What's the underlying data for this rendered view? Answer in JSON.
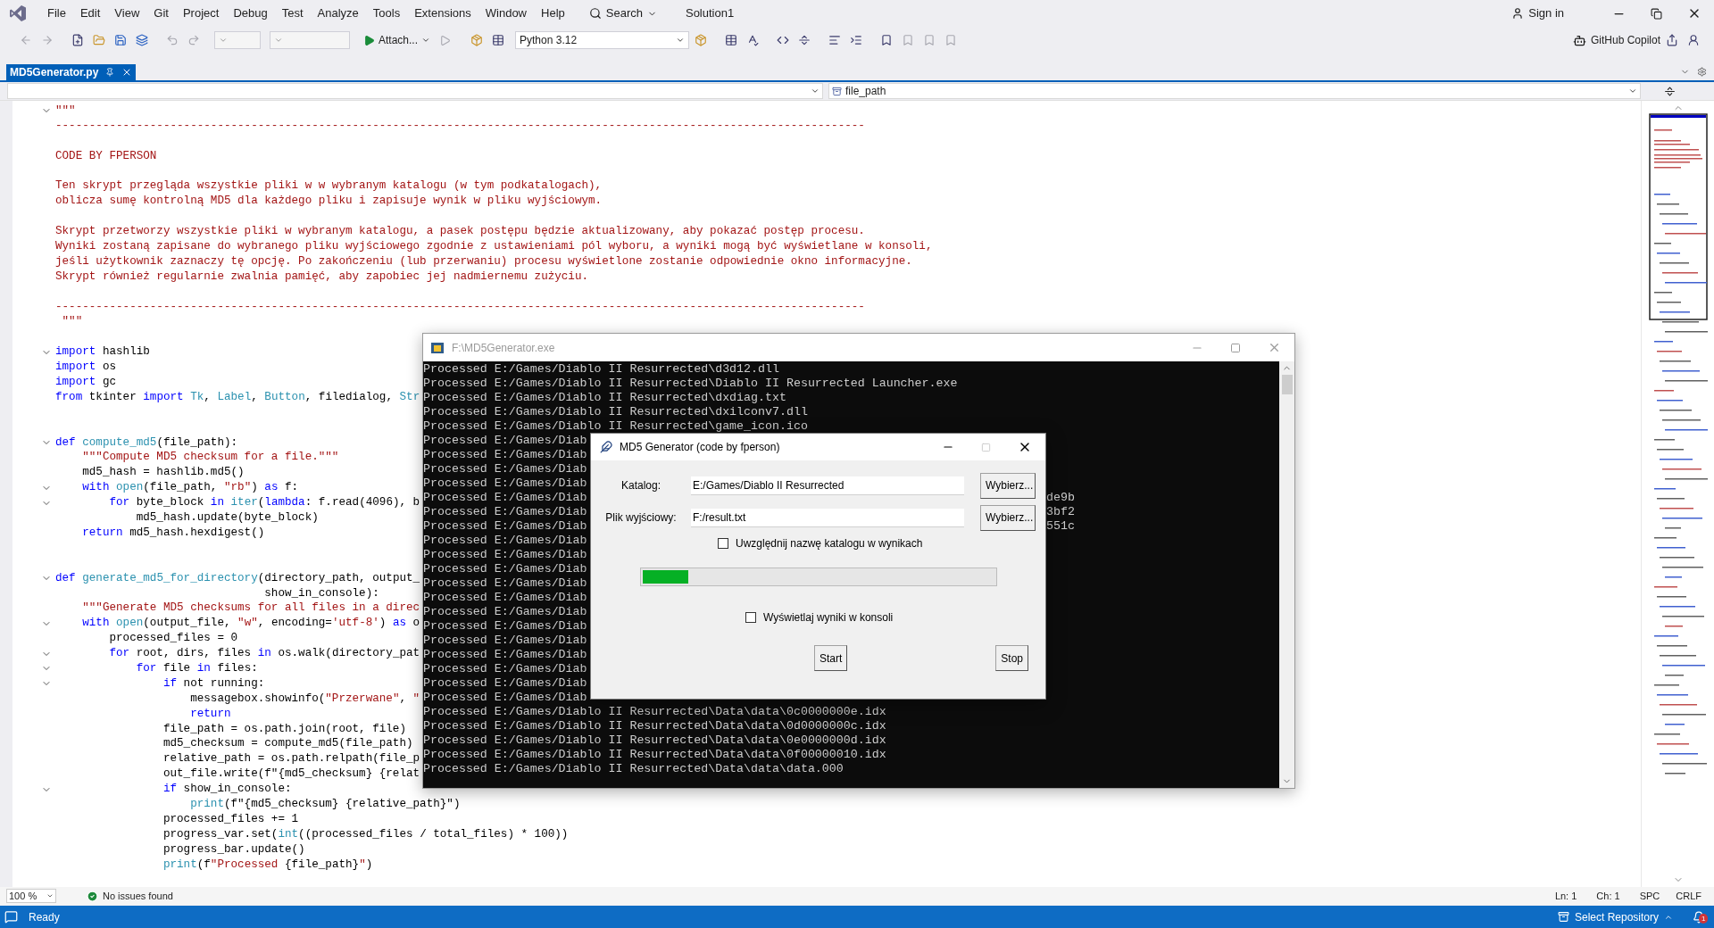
{
  "menu_bar": {
    "items": [
      "File",
      "Edit",
      "View",
      "Git",
      "Project",
      "Debug",
      "Test",
      "Analyze",
      "Tools",
      "Extensions",
      "Window",
      "Help"
    ],
    "search": "Search",
    "solution": "Solution1",
    "sign_in": "Sign in"
  },
  "toolbar": {
    "attach": "Attach...",
    "interpreter": "Python 3.12",
    "copilot": "GitHub Copilot"
  },
  "tabs": [
    {
      "label": "MD5Generator.py",
      "selected": true
    }
  ],
  "navigation": {
    "member": "file_path"
  },
  "editor": {
    "lines": [
      {
        "kind": "code",
        "foldable": true,
        "tokens": [
          {
            "kind": "string",
            "text": "\"\"\""
          }
        ]
      },
      {
        "kind": "code",
        "foldable": false,
        "tokens": [
          {
            "kind": "string",
            "text": "------------------------------------------------------------------------------------------------------------------------"
          }
        ]
      },
      {
        "kind": "blank",
        "foldable": false
      },
      {
        "kind": "code",
        "foldable": false,
        "tokens": [
          {
            "kind": "string",
            "text": "CODE BY FPERSON"
          }
        ]
      },
      {
        "kind": "blank",
        "foldable": false
      },
      {
        "kind": "code",
        "foldable": false,
        "tokens": [
          {
            "kind": "string",
            "text": "Ten skrypt przegląda wszystkie pliki w w wybranym katalogu (w tym podkatalogach),"
          }
        ]
      },
      {
        "kind": "code",
        "foldable": false,
        "tokens": [
          {
            "kind": "string",
            "text": "oblicza sumę kontrolną MD5 dla każdego pliku i zapisuje wynik w pliku wyjściowym."
          }
        ]
      },
      {
        "kind": "blank",
        "foldable": false
      },
      {
        "kind": "code",
        "foldable": false,
        "tokens": [
          {
            "kind": "string",
            "text": "Skrypt przetworzy wszystkie pliki w wybranym katalogu, a pasek postępu będzie aktualizowany, aby pokazać postęp procesu."
          }
        ]
      },
      {
        "kind": "code",
        "foldable": false,
        "tokens": [
          {
            "kind": "string",
            "text": "Wyniki zostaną zapisane do wybranego pliku wyjściowego zgodnie z ustawieniami pól wyboru, a wyniki mogą być wyświetlane w konsoli,"
          }
        ]
      },
      {
        "kind": "code",
        "foldable": false,
        "tokens": [
          {
            "kind": "string",
            "text": "jeśli użytkownik zaznaczy tę opcję. Po zakończeniu (lub przerwaniu) procesu wyświetlone zostanie odpowiednie okno informacyjne."
          }
        ]
      },
      {
        "kind": "code",
        "foldable": false,
        "tokens": [
          {
            "kind": "string",
            "text": "Skrypt również regularnie zwalnia pamięć, aby zapobiec jej nadmiernemu zużyciu."
          }
        ]
      },
      {
        "kind": "blank",
        "foldable": false
      },
      {
        "kind": "code",
        "foldable": false,
        "tokens": [
          {
            "kind": "string",
            "text": "------------------------------------------------------------------------------------------------------------------------"
          }
        ]
      },
      {
        "kind": "code",
        "foldable": false,
        "tokens": [
          {
            "kind": "string",
            "text": " \"\"\""
          }
        ]
      },
      {
        "kind": "blank",
        "foldable": false
      },
      {
        "kind": "code",
        "foldable": true,
        "tokens": [
          {
            "kind": "keyword",
            "text": "import"
          },
          {
            "kind": "plain",
            "text": " hashlib"
          }
        ]
      },
      {
        "kind": "code",
        "foldable": false,
        "tokens": [
          {
            "kind": "keyword",
            "text": "import"
          },
          {
            "kind": "plain",
            "text": " os"
          }
        ]
      },
      {
        "kind": "code",
        "foldable": false,
        "tokens": [
          {
            "kind": "keyword",
            "text": "import"
          },
          {
            "kind": "plain",
            "text": " gc"
          }
        ]
      },
      {
        "kind": "code",
        "foldable": false,
        "tokens": [
          {
            "kind": "keyword",
            "text": "from"
          },
          {
            "kind": "plain",
            "text": " tkinter "
          },
          {
            "kind": "keyword",
            "text": "import"
          },
          {
            "kind": "name",
            "text": " Tk"
          },
          {
            "kind": "plain",
            "text": ", "
          },
          {
            "kind": "name",
            "text": "Label"
          },
          {
            "kind": "plain",
            "text": ", "
          },
          {
            "kind": "name",
            "text": "Button"
          },
          {
            "kind": "plain",
            "text": ", filedialog, "
          },
          {
            "kind": "name",
            "text": "Str"
          }
        ]
      },
      {
        "kind": "blank",
        "foldable": false
      },
      {
        "kind": "blank",
        "foldable": false
      },
      {
        "kind": "code",
        "foldable": true,
        "tokens": [
          {
            "kind": "keyword",
            "text": "def"
          },
          {
            "kind": "name",
            "text": " compute_md5"
          },
          {
            "kind": "plain",
            "text": "(file_path):"
          }
        ]
      },
      {
        "kind": "code",
        "foldable": false,
        "tokens": [
          {
            "kind": "string",
            "text": "    \"\"\"Compute MD5 checksum for a file.\"\"\""
          }
        ]
      },
      {
        "kind": "code",
        "foldable": false,
        "tokens": [
          {
            "kind": "plain",
            "text": "    md5_hash = hashlib.md5()"
          }
        ]
      },
      {
        "kind": "code",
        "foldable": true,
        "tokens": [
          {
            "kind": "keyword",
            "text": "    with"
          },
          {
            "kind": "name",
            "text": " open"
          },
          {
            "kind": "plain",
            "text": "(file_path, "
          },
          {
            "kind": "string",
            "text": "\"rb\""
          },
          {
            "kind": "plain",
            "text": ") "
          },
          {
            "kind": "keyword",
            "text": "as"
          },
          {
            "kind": "plain",
            "text": " f:"
          }
        ]
      },
      {
        "kind": "code",
        "foldable": true,
        "tokens": [
          {
            "kind": "keyword",
            "text": "        for"
          },
          {
            "kind": "plain",
            "text": " byte_block "
          },
          {
            "kind": "keyword",
            "text": "in"
          },
          {
            "kind": "name",
            "text": " iter"
          },
          {
            "kind": "plain",
            "text": "("
          },
          {
            "kind": "keyword",
            "text": "lambda"
          },
          {
            "kind": "plain",
            "text": ": f.read(4096), b"
          }
        ]
      },
      {
        "kind": "code",
        "foldable": false,
        "tokens": [
          {
            "kind": "plain",
            "text": "            md5_hash.update(byte_block)"
          }
        ]
      },
      {
        "kind": "code",
        "foldable": false,
        "tokens": [
          {
            "kind": "keyword",
            "text": "    return"
          },
          {
            "kind": "plain",
            "text": " md5_hash.hexdigest()"
          }
        ]
      },
      {
        "kind": "blank",
        "foldable": false
      },
      {
        "kind": "blank",
        "foldable": false
      },
      {
        "kind": "code",
        "foldable": true,
        "tokens": [
          {
            "kind": "keyword",
            "text": "def"
          },
          {
            "kind": "name",
            "text": " generate_md5_for_directory"
          },
          {
            "kind": "plain",
            "text": "(directory_path, output_"
          }
        ]
      },
      {
        "kind": "code",
        "foldable": false,
        "tokens": [
          {
            "kind": "plain",
            "text": "                               show_in_console):"
          }
        ]
      },
      {
        "kind": "code",
        "foldable": false,
        "tokens": [
          {
            "kind": "string",
            "text": "    \"\"\"Generate MD5 checksums for all files in a direc"
          }
        ]
      },
      {
        "kind": "code",
        "foldable": true,
        "tokens": [
          {
            "kind": "keyword",
            "text": "    with"
          },
          {
            "kind": "name",
            "text": " open"
          },
          {
            "kind": "plain",
            "text": "(output_file, "
          },
          {
            "kind": "string",
            "text": "\"w\""
          },
          {
            "kind": "plain",
            "text": ", encoding="
          },
          {
            "kind": "string",
            "text": "'utf-8'"
          },
          {
            "kind": "plain",
            "text": ") "
          },
          {
            "kind": "keyword",
            "text": "as"
          },
          {
            "kind": "plain",
            "text": " o"
          }
        ]
      },
      {
        "kind": "code",
        "foldable": false,
        "tokens": [
          {
            "kind": "plain",
            "text": "        processed_files = 0"
          }
        ]
      },
      {
        "kind": "code",
        "foldable": true,
        "tokens": [
          {
            "kind": "keyword",
            "text": "        for"
          },
          {
            "kind": "plain",
            "text": " root, dirs, files "
          },
          {
            "kind": "keyword",
            "text": "in"
          },
          {
            "kind": "plain",
            "text": " os.walk(directory_pat"
          }
        ]
      },
      {
        "kind": "code",
        "foldable": true,
        "tokens": [
          {
            "kind": "keyword",
            "text": "            for"
          },
          {
            "kind": "plain",
            "text": " file "
          },
          {
            "kind": "keyword",
            "text": "in"
          },
          {
            "kind": "plain",
            "text": " files:"
          }
        ]
      },
      {
        "kind": "code",
        "foldable": true,
        "tokens": [
          {
            "kind": "keyword",
            "text": "                if"
          },
          {
            "kind": "plain",
            "text": " not running:"
          }
        ]
      },
      {
        "kind": "code",
        "foldable": false,
        "tokens": [
          {
            "kind": "plain",
            "text": "                    messagebox.showinfo("
          },
          {
            "kind": "string",
            "text": "\"Przerwane\""
          },
          {
            "kind": "plain",
            "text": ", "
          },
          {
            "kind": "string",
            "text": "\""
          }
        ]
      },
      {
        "kind": "code",
        "foldable": false,
        "tokens": [
          {
            "kind": "keyword",
            "text": "                    return"
          }
        ]
      },
      {
        "kind": "code",
        "foldable": false,
        "tokens": [
          {
            "kind": "plain",
            "text": "                file_path = os.path.join(root, file)"
          }
        ]
      },
      {
        "kind": "code",
        "foldable": false,
        "tokens": [
          {
            "kind": "plain",
            "text": "                md5_checksum = compute_md5(file_path)"
          }
        ]
      },
      {
        "kind": "code",
        "foldable": false,
        "tokens": [
          {
            "kind": "plain",
            "text": "                relative_path = os.path.relpath(file_p"
          }
        ]
      },
      {
        "kind": "code",
        "foldable": false,
        "tokens": [
          {
            "kind": "plain",
            "text": "                out_file.write(f\"{md5_checksum} {relat"
          }
        ]
      },
      {
        "kind": "code",
        "foldable": true,
        "tokens": [
          {
            "kind": "keyword",
            "text": "                if"
          },
          {
            "kind": "plain",
            "text": " show_in_console:"
          }
        ]
      },
      {
        "kind": "code",
        "foldable": false,
        "tokens": [
          {
            "kind": "name",
            "text": "                    print"
          },
          {
            "kind": "plain",
            "text": "(f\"{md5_checksum} {relative_path}\")"
          }
        ]
      },
      {
        "kind": "code",
        "foldable": false,
        "tokens": [
          {
            "kind": "plain",
            "text": "                processed_files += 1"
          }
        ]
      },
      {
        "kind": "code",
        "foldable": false,
        "tokens": [
          {
            "kind": "plain",
            "text": "                progress_var.set("
          },
          {
            "kind": "name",
            "text": "int"
          },
          {
            "kind": "plain",
            "text": "((processed_files / total_files) * 100))"
          }
        ]
      },
      {
        "kind": "code",
        "foldable": false,
        "tokens": [
          {
            "kind": "plain",
            "text": "                progress_bar.update()"
          }
        ]
      },
      {
        "kind": "code",
        "foldable": false,
        "tokens": [
          {
            "kind": "name",
            "text": "                print"
          },
          {
            "kind": "plain",
            "text": "(f"
          },
          {
            "kind": "string",
            "text": "\"Processed "
          },
          {
            "kind": "plain",
            "text": "{file_path}"
          },
          {
            "kind": "string",
            "text": "\""
          },
          {
            "kind": "plain",
            "text": ")"
          }
        ]
      }
    ]
  },
  "editor_status": {
    "zoom": "100 %",
    "issues": "No issues found",
    "line": "Ln: 1",
    "column": "Ch: 1",
    "indentation": "SPC",
    "line_ending": "CRLF"
  },
  "status_bar": {
    "state": "Ready",
    "repository": "Select Repository",
    "notifications": "1"
  },
  "console_window": {
    "title": "F:\\MD5Generator.exe",
    "lines": [
      {
        "text": "Processed E:/Games/Diablo II Resurrected\\d3d12.dll"
      },
      {
        "text": "Processed E:/Games/Diablo II Resurrected\\Diablo II Resurrected Launcher.exe"
      },
      {
        "text": "Processed E:/Games/Diablo II Resurrected\\dxdiag.txt"
      },
      {
        "text": "Processed E:/Games/Diablo II Resurrected\\dxilconv7.dll"
      },
      {
        "text": "Processed E:/Games/Diablo II Resurrected\\game_icon.ico"
      },
      {
        "text": "Processed E:/Games/Diab"
      },
      {
        "text": "Processed E:/Games/Diab"
      },
      {
        "text": "Processed E:/Games/Diab"
      },
      {
        "text": "Processed E:/Games/Diab"
      },
      {
        "text": "Processed E:/Games/Diab",
        "tail": "de9b"
      },
      {
        "text": "Processed E:/Games/Diab",
        "tail": "3bf2"
      },
      {
        "text": "Processed E:/Games/Diab",
        "tail": "551c"
      },
      {
        "text": "Processed E:/Games/Diab"
      },
      {
        "text": "Processed E:/Games/Diab"
      },
      {
        "text": "Processed E:/Games/Diab"
      },
      {
        "text": "Processed E:/Games/Diab"
      },
      {
        "text": "Processed E:/Games/Diab"
      },
      {
        "text": "Processed E:/Games/Diab"
      },
      {
        "text": "Processed E:/Games/Diab"
      },
      {
        "text": "Processed E:/Games/Diab"
      },
      {
        "text": "Processed E:/Games/Diab"
      },
      {
        "text": "Processed E:/Games/Diab"
      },
      {
        "text": "Processed E:/Games/Diab"
      },
      {
        "text": "Processed E:/Games/Diab"
      },
      {
        "text": "Processed E:/Games/Diablo II Resurrected\\Data\\data\\0c0000000e.idx"
      },
      {
        "text": "Processed E:/Games/Diablo II Resurrected\\Data\\data\\0d0000000c.idx"
      },
      {
        "text": "Processed E:/Games/Diablo II Resurrected\\Data\\data\\0e0000000d.idx"
      },
      {
        "text": "Processed E:/Games/Diablo II Resurrected\\Data\\data\\0f00000010.idx"
      },
      {
        "text": "Processed E:/Games/Diablo II Resurrected\\Data\\data\\data.000"
      }
    ]
  },
  "dialog": {
    "title": "MD5 Generator (code by fperson)",
    "fields": [
      {
        "label": "Katalog:",
        "value": "E:/Games/Diablo II Resurrected",
        "button": "Wybierz..."
      },
      {
        "label": "Plik wyjściowy:",
        "value": "F:/result.txt",
        "button": "Wybierz..."
      }
    ],
    "options": [
      {
        "label": "Uwzględnij nazwę katalogu w wynikach",
        "checked": false
      },
      {
        "label": "Wyświetlaj wyniki w konsoli",
        "checked": false
      }
    ],
    "progress": {
      "level": 0.13
    },
    "buttons": [
      "Start",
      "Stop"
    ]
  }
}
